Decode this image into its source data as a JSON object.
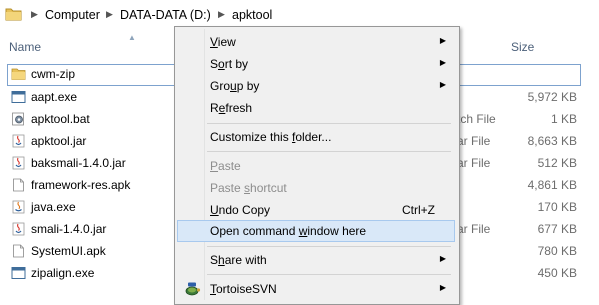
{
  "breadcrumb": {
    "items": [
      "Computer",
      "DATA-DATA (D:)",
      "apktool"
    ]
  },
  "columns": {
    "name": "Name",
    "size": "Size"
  },
  "files": [
    {
      "name": "cwm-zip",
      "type": "",
      "size": "",
      "icon": "folder-icon",
      "selected": true
    },
    {
      "name": "aapt.exe",
      "type": "",
      "size": "5,972 KB",
      "icon": "exe-icon"
    },
    {
      "name": "apktool.bat",
      "type": "tch File",
      "size": "1 KB",
      "icon": "bat-icon"
    },
    {
      "name": "apktool.jar",
      "type": "ar File",
      "size": "8,663 KB",
      "icon": "jar-icon"
    },
    {
      "name": "baksmali-1.4.0.jar",
      "type": "ar File",
      "size": "512 KB",
      "icon": "jar-icon"
    },
    {
      "name": "framework-res.apk",
      "type": "",
      "size": "4,861 KB",
      "icon": "file-icon"
    },
    {
      "name": "java.exe",
      "type": "",
      "size": "170 KB",
      "icon": "java-icon"
    },
    {
      "name": "smali-1.4.0.jar",
      "type": "ar File",
      "size": "677 KB",
      "icon": "jar-icon"
    },
    {
      "name": "SystemUI.apk",
      "type": "",
      "size": "780 KB",
      "icon": "file-icon"
    },
    {
      "name": "zipalign.exe",
      "type": "",
      "size": "450 KB",
      "icon": "exe-icon"
    }
  ],
  "context_menu": {
    "view": {
      "pre": "",
      "ul": "V",
      "post": "iew"
    },
    "sort_by": {
      "pre": "S",
      "ul": "o",
      "post": "rt by"
    },
    "group_by": {
      "pre": "Gro",
      "ul": "u",
      "post": "p by"
    },
    "refresh": {
      "pre": "R",
      "ul": "e",
      "post": "fresh"
    },
    "customize": {
      "pre": "Customize this ",
      "ul": "f",
      "post": "older..."
    },
    "paste": {
      "pre": "",
      "ul": "P",
      "post": "aste"
    },
    "paste_shortcut": {
      "pre": "Paste ",
      "ul": "s",
      "post": "hortcut"
    },
    "undo_copy": {
      "pre": "",
      "ul": "U",
      "post": "ndo Copy"
    },
    "undo_copy_shortcut": "Ctrl+Z",
    "open_cmd": {
      "pre": "Open command ",
      "ul": "w",
      "post": "indow here"
    },
    "share_with": {
      "pre": "S",
      "ul": "h",
      "post": "are with"
    },
    "tortoise": {
      "pre": "",
      "ul": "T",
      "post": "ortoiseSVN"
    }
  },
  "colors": {
    "hover_bg": "#d9e8f8",
    "hover_border": "#a8c9ee",
    "selection_border": "#7da2ce",
    "header_text": "#4c607a"
  }
}
